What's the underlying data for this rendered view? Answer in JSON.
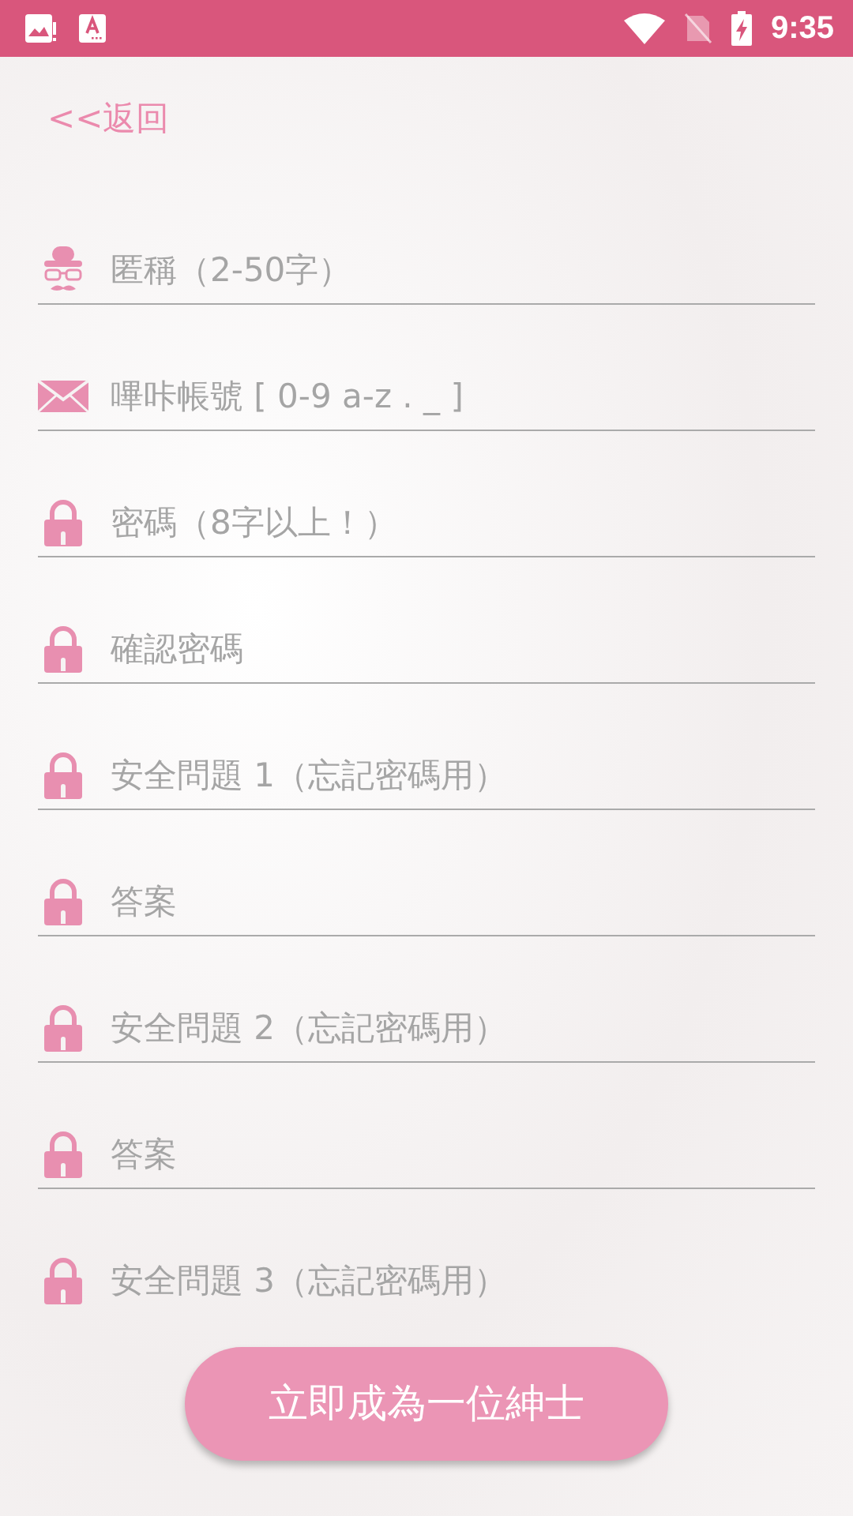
{
  "status_bar": {
    "time": "9:35"
  },
  "back_link": "<<返回",
  "fields": [
    {
      "kind": "gentleman",
      "placeholder": "匿稱（2-50字）"
    },
    {
      "kind": "envelope",
      "placeholder": "嗶咔帳號 [ 0-9 a-z . _ ]"
    },
    {
      "kind": "lock",
      "placeholder": "密碼（8字以上！）"
    },
    {
      "kind": "lock",
      "placeholder": "確認密碼"
    },
    {
      "kind": "lock",
      "placeholder": "安全問題 1（忘記密碼用）"
    },
    {
      "kind": "lock",
      "placeholder": "答案"
    },
    {
      "kind": "lock",
      "placeholder": "安全問題 2（忘記密碼用）"
    },
    {
      "kind": "lock",
      "placeholder": "答案"
    },
    {
      "kind": "lock",
      "placeholder": "安全問題 3（忘記密碼用）"
    }
  ],
  "submit_button": "立即成為一位紳士"
}
